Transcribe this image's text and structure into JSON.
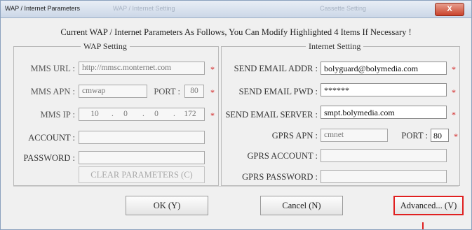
{
  "window": {
    "title": "WAP / Internet Parameters",
    "ghost_titles": [
      "WAP / Internet Setting",
      "Cassette Setting"
    ],
    "close_label": "X"
  },
  "header": "Current WAP / Internet Parameters As Follows, You Can Modify Highlighted 4 Items If Necessary !",
  "wap": {
    "legend": "WAP Setting",
    "mms_url_label": "MMS URL :",
    "mms_url_value": "http://mmsc.monternet.com",
    "mms_apn_label": "MMS APN :",
    "mms_apn_value": "cmwap",
    "port_label": "PORT :",
    "port_value": "80",
    "mms_ip_label": "MMS IP :",
    "mms_ip": [
      "10",
      "0",
      "0",
      "172"
    ],
    "account_label": "ACCOUNT :",
    "account_value": "",
    "password_label": "PASSWORD :",
    "password_value": "",
    "clear_button": "CLEAR PARAMETERS (C)"
  },
  "internet": {
    "legend": "Internet Setting",
    "send_email_addr_label": "SEND EMAIL ADDR :",
    "send_email_addr_value": "bolyguard@bolymedia.com",
    "send_email_pwd_label": "SEND EMAIL PWD :",
    "send_email_pwd_value": "******",
    "send_email_server_label": "SEND EMAIL SERVER :",
    "send_email_server_value": "smpt.bolymedia.com",
    "gprs_apn_label": "GPRS APN :",
    "gprs_apn_value": "cmnet",
    "port_label": "PORT :",
    "port_value": "80",
    "gprs_account_label": "GPRS ACCOUNT :",
    "gprs_account_value": "",
    "gprs_password_label": "GPRS PASSWORD :",
    "gprs_password_value": ""
  },
  "buttons": {
    "ok": "OK (Y)",
    "cancel": "Cancel (N)",
    "advanced": "Advanced... (V)"
  },
  "required_mark": "*",
  "colors": {
    "required": "#d21f1f",
    "highlight_box": "#e02020",
    "close_button": "#c9432c"
  }
}
